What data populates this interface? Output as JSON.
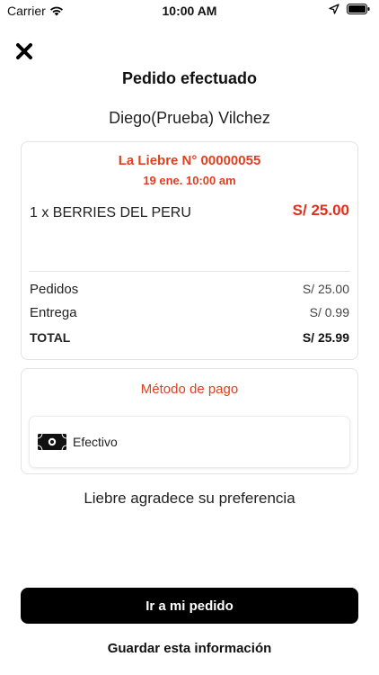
{
  "status_bar": {
    "carrier": "Carrier",
    "time": "10:00 AM"
  },
  "header": {
    "title": "Pedido efectuado",
    "close_icon": "close-icon"
  },
  "customer": {
    "name": "Diego(Prueba) Vilchez"
  },
  "order": {
    "title": "La Liebre N° 00000055",
    "date": "19 ene. 10:00 am",
    "items": [
      {
        "description": "1 x BERRIES DEL PERU",
        "price": "S/ 25.00"
      }
    ],
    "summary": {
      "orders_label": "Pedidos",
      "orders_value": "S/ 25.00",
      "delivery_label": "Entrega",
      "delivery_value": "S/ 0.99",
      "total_label": "TOTAL",
      "total_value": "S/ 25.99"
    }
  },
  "payment": {
    "title": "Método de pago",
    "method_label": "Efectivo",
    "method_icon": "cash-icon"
  },
  "thanks_message": "Liebre agradece su preferencia",
  "actions": {
    "primary_label": "Ir a mi pedido",
    "secondary_label": "Guardar esta información"
  },
  "colors": {
    "accent": "#e0401f",
    "button_bg": "#000000"
  }
}
